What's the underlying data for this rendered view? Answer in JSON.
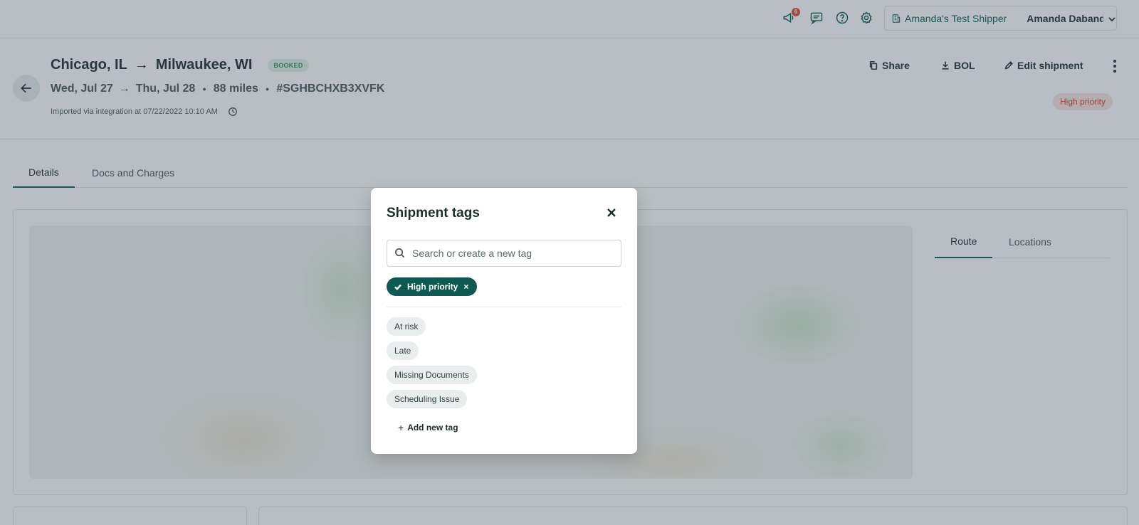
{
  "topbar": {
    "notification_count": "6",
    "shipper_name": "Amanda's Test Shipper",
    "user_name": "Amanda Daband..."
  },
  "header": {
    "origin": "Chicago, IL",
    "route_arrow": "→",
    "destination": "Milwaukee, WI",
    "status": "BOOKED",
    "pickup_date": "Wed, Jul 27",
    "date_arrow": "→",
    "delivery_date": "Thu, Jul 28",
    "distance": "88 miles",
    "reference": "#SGHBCHXB3XVFK",
    "bullet": "●",
    "imported_text": "Imported via integration at 07/22/2022 10:10 AM",
    "actions": {
      "share": "Share",
      "bol": "BOL",
      "edit": "Edit shipment"
    },
    "priority_tag": "High priority"
  },
  "tabs": [
    {
      "label": "Details"
    },
    {
      "label": "Docs and Charges"
    }
  ],
  "side_tabs": [
    {
      "label": "Route"
    },
    {
      "label": "Locations"
    }
  ],
  "modal": {
    "title": "Shipment tags",
    "search_placeholder": "Search or create a new tag",
    "selected_tags": [
      {
        "label": "High priority",
        "remove": "×"
      }
    ],
    "available_tags": [
      {
        "label": "At risk"
      },
      {
        "label": "Late"
      },
      {
        "label": "Missing Documents"
      },
      {
        "label": "Scheduling Issue"
      }
    ],
    "add_plus": "+",
    "add_new_label": "Add new tag"
  },
  "colors": {
    "brand": "#0e5a52",
    "danger": "#c8423a",
    "booked": "#2f8a5e"
  }
}
